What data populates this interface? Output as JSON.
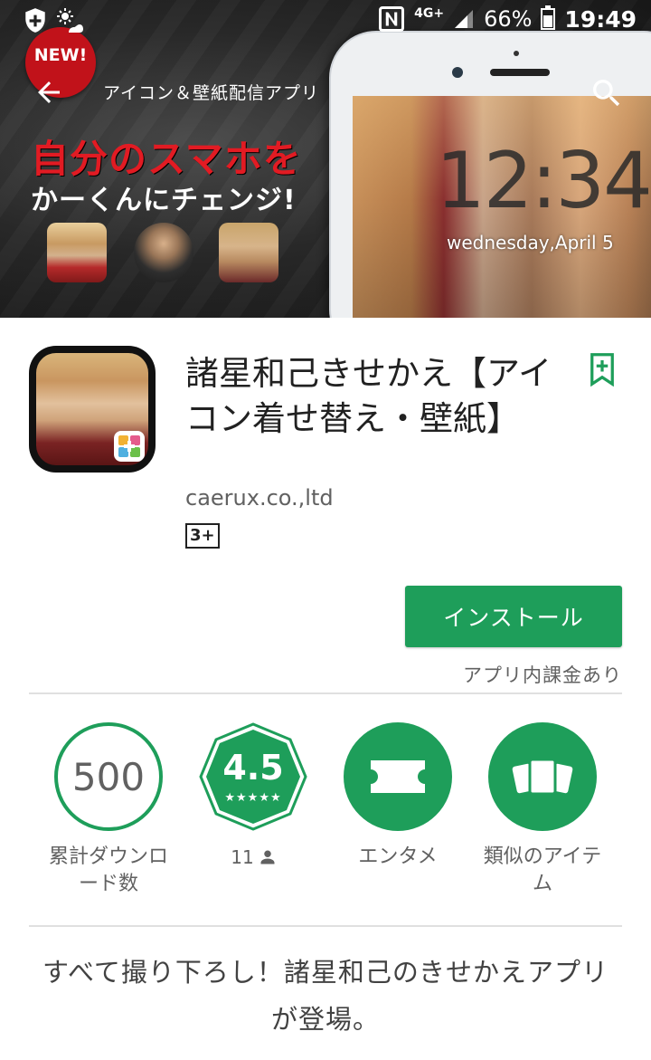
{
  "status_bar": {
    "network": "4G+",
    "battery": "66%",
    "time": "19:49"
  },
  "banner": {
    "badge": "NEW!",
    "tagline": "アイコン＆壁紙配信アプリ",
    "headline": "自分のスマホを",
    "subheadline": "かーくんにチェンジ!",
    "phone_time": "12:34",
    "phone_date": "wednesday,April 5"
  },
  "app": {
    "title": "諸星和己きせかえ【アイコン着せ替え・壁紙】",
    "developer": "caerux.co.,ltd",
    "content_rating": "3+",
    "install_label": "インストール",
    "iap_note": "アプリ内課金あり"
  },
  "stats": {
    "downloads_value": "500",
    "downloads_label": "累計ダウンロード数",
    "rating_value": "4.5",
    "rating_stars": "★★★★★",
    "rating_count": "11",
    "category_label": "エンタメ",
    "similar_label": "類似のアイテム"
  },
  "description": "すべて撮り下ろし！諸星和己のきせかえアプリが登場。",
  "colors": {
    "accent": "#1e9e5a",
    "badge_red": "#c1121a"
  },
  "icons": [
    "shield-plus-icon",
    "brightness-auto-icon",
    "nfc-icon",
    "signal-icon",
    "battery-icon",
    "back-arrow-icon",
    "search-icon",
    "bookmark-add-icon",
    "person-icon",
    "ticket-icon",
    "cards-icon"
  ]
}
